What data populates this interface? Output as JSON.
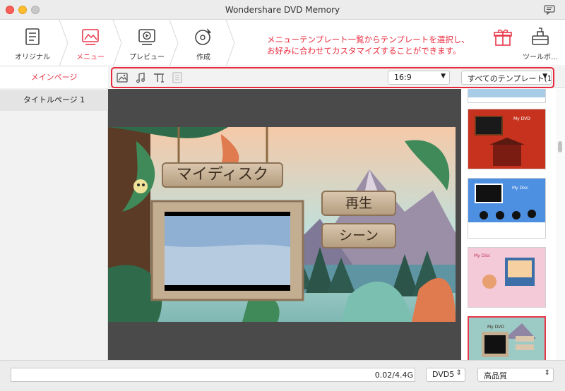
{
  "window": {
    "title": "Wondershare DVD Memory"
  },
  "steps": [
    {
      "label": "オリジナル",
      "icon": "original-icon"
    },
    {
      "label": "メニュー",
      "icon": "menu-icon"
    },
    {
      "label": "プレビュー",
      "icon": "preview-icon"
    },
    {
      "label": "作成",
      "icon": "burn-disc-icon"
    }
  ],
  "toolbox": {
    "label": "ツールボ…",
    "icon": "toolbox-icon"
  },
  "gift": {
    "icon": "gift-icon"
  },
  "annotation": {
    "line1": "メニューテンプレート一覧からテンプレートを選択し、",
    "line2": "お好みに合わせてカスタマイズすることができます。"
  },
  "sidebar": {
    "main_page": "メインページ",
    "title_page": "タイトルページ 1"
  },
  "edit_toolbar": {
    "icons": [
      "image-icon",
      "music-icon",
      "text-icon",
      "chapter-icon"
    ],
    "aspect_ratio": "16:9",
    "template_filter": "すべてのテンプレート(12…"
  },
  "menu_preview": {
    "disc_title": "マイディスク",
    "play_button": "再生",
    "scenes_button": "シーン"
  },
  "templates": [
    {
      "name": "template-1",
      "text": ""
    },
    {
      "name": "template-2",
      "text": "My DVD"
    },
    {
      "name": "template-3",
      "text": "My Disc"
    },
    {
      "name": "template-4",
      "text": "My Disc"
    },
    {
      "name": "template-5",
      "text": "My DVD"
    }
  ],
  "bottom": {
    "capacity": "0.02/4.4G",
    "disc_type": "DVD5",
    "quality": "高品質"
  },
  "colors": {
    "accent": "#e8374a",
    "highlight": "#e8283c"
  }
}
